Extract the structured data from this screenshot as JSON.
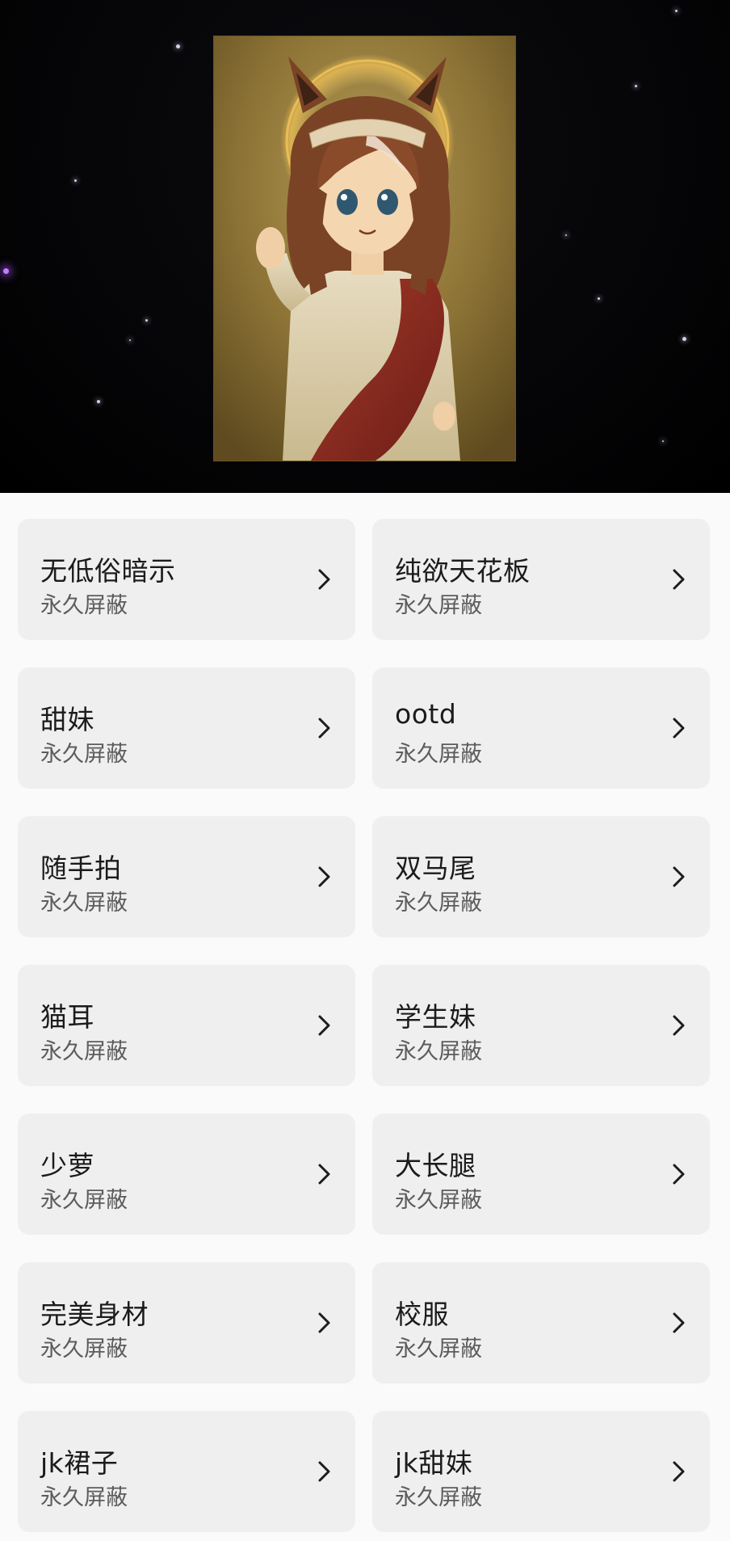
{
  "header": {
    "image_alt": "",
    "background_color": "#000000"
  },
  "settings_list": {
    "items": [
      {
        "title": "无低俗暗示",
        "status": "永久屏蔽"
      },
      {
        "title": "纯欲天花板",
        "status": "永久屏蔽"
      },
      {
        "title": "甜妹",
        "status": "永久屏蔽"
      },
      {
        "title": "ootd",
        "status": "永久屏蔽"
      },
      {
        "title": "随手拍",
        "status": "永久屏蔽"
      },
      {
        "title": "双马尾",
        "status": "永久屏蔽"
      },
      {
        "title": "猫耳",
        "status": "永久屏蔽"
      },
      {
        "title": "学生妹",
        "status": "永久屏蔽"
      },
      {
        "title": "少萝",
        "status": "永久屏蔽"
      },
      {
        "title": "大长腿",
        "status": "永久屏蔽"
      },
      {
        "title": "完美身材",
        "status": "永久屏蔽"
      },
      {
        "title": "校服",
        "status": "永久屏蔽"
      },
      {
        "title": "jk裙子",
        "status": "永久屏蔽"
      },
      {
        "title": "jk甜妹",
        "status": "永久屏蔽"
      }
    ],
    "chevron_icon": "chevron-right-icon"
  },
  "colors": {
    "card_background": "#efefef",
    "title_text": "#1b1b1b",
    "subtitle_text": "#5c5c5c",
    "page_background": "#fafafa"
  }
}
